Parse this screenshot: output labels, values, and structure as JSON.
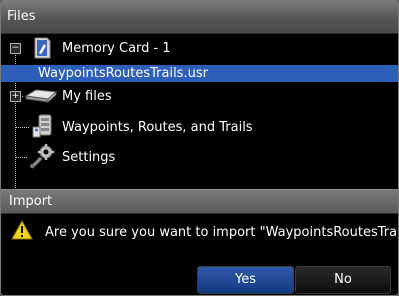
{
  "window": {
    "title": "Files"
  },
  "tree": {
    "items": [
      {
        "label": "Memory Card - 1",
        "icon": "memory-card-icon",
        "expander": "−"
      },
      {
        "label": "WaypointsRoutesTrails.usr",
        "icon": "",
        "selected": true
      },
      {
        "label": "My files",
        "icon": "hard-drive-icon",
        "expander": "+"
      },
      {
        "label": "Waypoints, Routes, and Trails",
        "icon": "database-icon"
      },
      {
        "label": "Settings",
        "icon": "wrench-gear-icon"
      }
    ]
  },
  "dialog": {
    "title": "Import",
    "message": "Are you sure you want to import \"WaypointsRoutesTrails.usr\"?",
    "icon": "warning-icon",
    "yes_label": "Yes",
    "no_label": "No"
  },
  "colors": {
    "selection": "#2d5fb8",
    "yes_button": "#1f4a96",
    "title_bar": "#5a5a5a"
  }
}
